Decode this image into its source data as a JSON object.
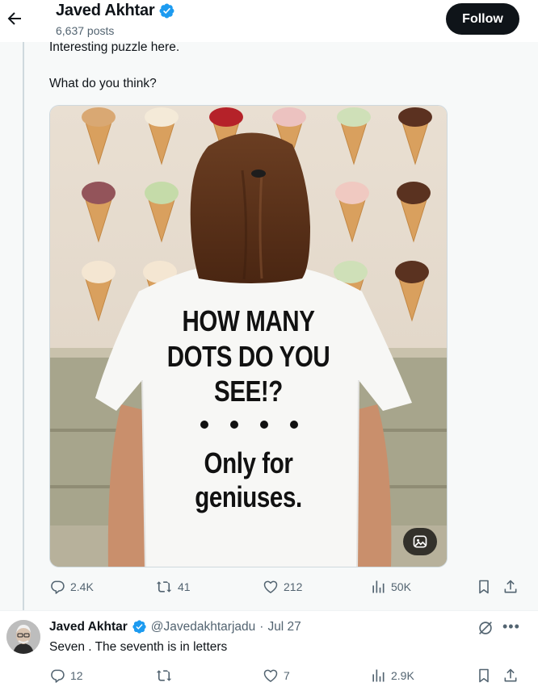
{
  "header": {
    "name": "Javed Akhtar",
    "posts": "6,637 posts",
    "follow_label": "Follow"
  },
  "tweet": {
    "text_line1": "Interesting puzzle here.",
    "text_line2": "What do you think?",
    "image": {
      "shirt_lines": [
        "HOW MANY",
        "DOTS DO YOU",
        "SEE!?",
        "Only for",
        "geniuses."
      ],
      "dot_count_visible": 4
    },
    "stats": {
      "replies": "2.4K",
      "reposts": "41",
      "likes": "212",
      "views": "50K"
    }
  },
  "reply": {
    "name": "Javed Akhtar",
    "handle": "@Javedakhtarjadu",
    "separator": "·",
    "date": "Jul 27",
    "text": "Seven . The seventh is in letters",
    "stats": {
      "replies": "12",
      "reposts": "",
      "likes": "7",
      "views": "2.9K"
    }
  },
  "colors": {
    "verified": "#1d9bf0",
    "follow_bg": "#0f1419",
    "muted": "#536471"
  },
  "icons": [
    "back-arrow-icon",
    "verified-badge-icon",
    "alt-text-icon",
    "reply-icon",
    "repost-icon",
    "like-icon",
    "views-icon",
    "bookmark-icon",
    "share-icon",
    "grok-icon",
    "more-icon"
  ]
}
